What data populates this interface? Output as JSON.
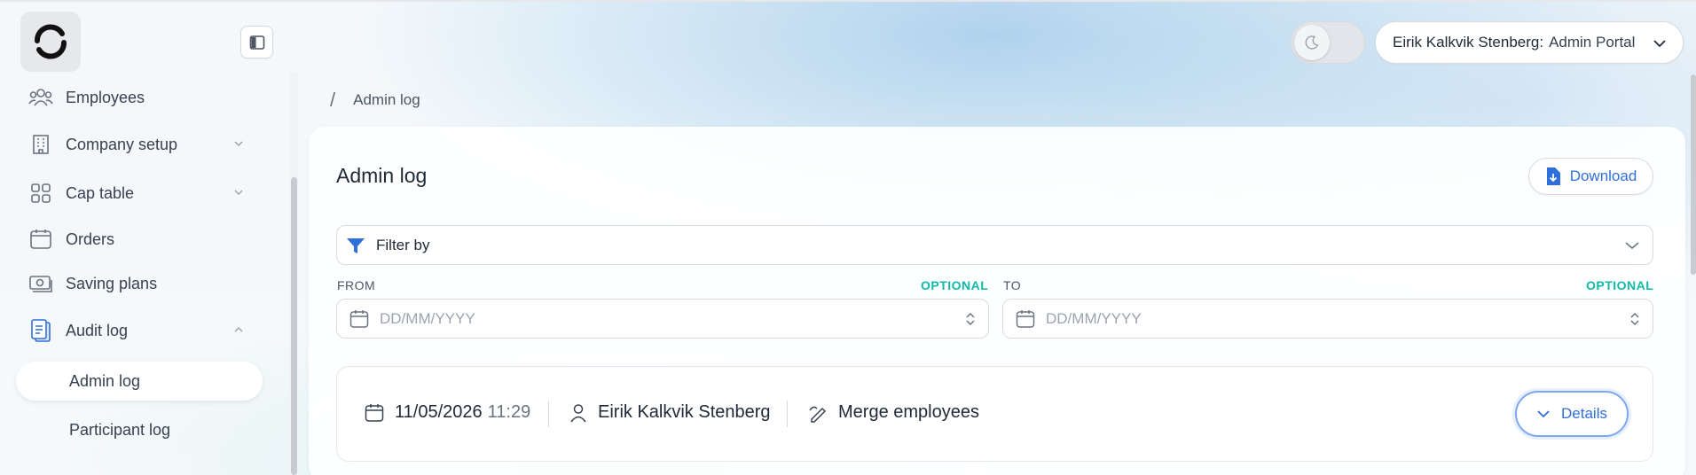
{
  "header": {
    "user_name": "Eirik Kalkvik Stenberg:",
    "portal": "Admin Portal"
  },
  "sidebar": {
    "items": [
      {
        "label": "Employees",
        "icon": "users-icon"
      },
      {
        "label": "Company setup",
        "icon": "building-icon"
      },
      {
        "label": "Cap table",
        "icon": "grid-icon"
      },
      {
        "label": "Orders",
        "icon": "calendar-icon"
      },
      {
        "label": "Saving plans",
        "icon": "cash-icon"
      },
      {
        "label": "Audit log",
        "icon": "clipboard-icon"
      }
    ],
    "sub_items": [
      {
        "label": "Admin log",
        "active": true
      },
      {
        "label": "Participant log",
        "active": false
      }
    ]
  },
  "breadcrumb": {
    "separator": "/",
    "current": "Admin log"
  },
  "main": {
    "title": "Admin log",
    "download_label": "Download",
    "filter_label": "Filter by",
    "from_label": "FROM",
    "to_label": "TO",
    "optional_label": "OPTIONAL",
    "date_placeholder": "DD/MM/YYYY"
  },
  "log_entries": [
    {
      "date": "11/05/2026",
      "time": "11:29",
      "user": "Eirik Kalkvik Stenberg",
      "action": "Merge employees",
      "details_label": "Details"
    }
  ],
  "colors": {
    "accent": "#2f6fdb",
    "optional": "#14b8a6"
  }
}
